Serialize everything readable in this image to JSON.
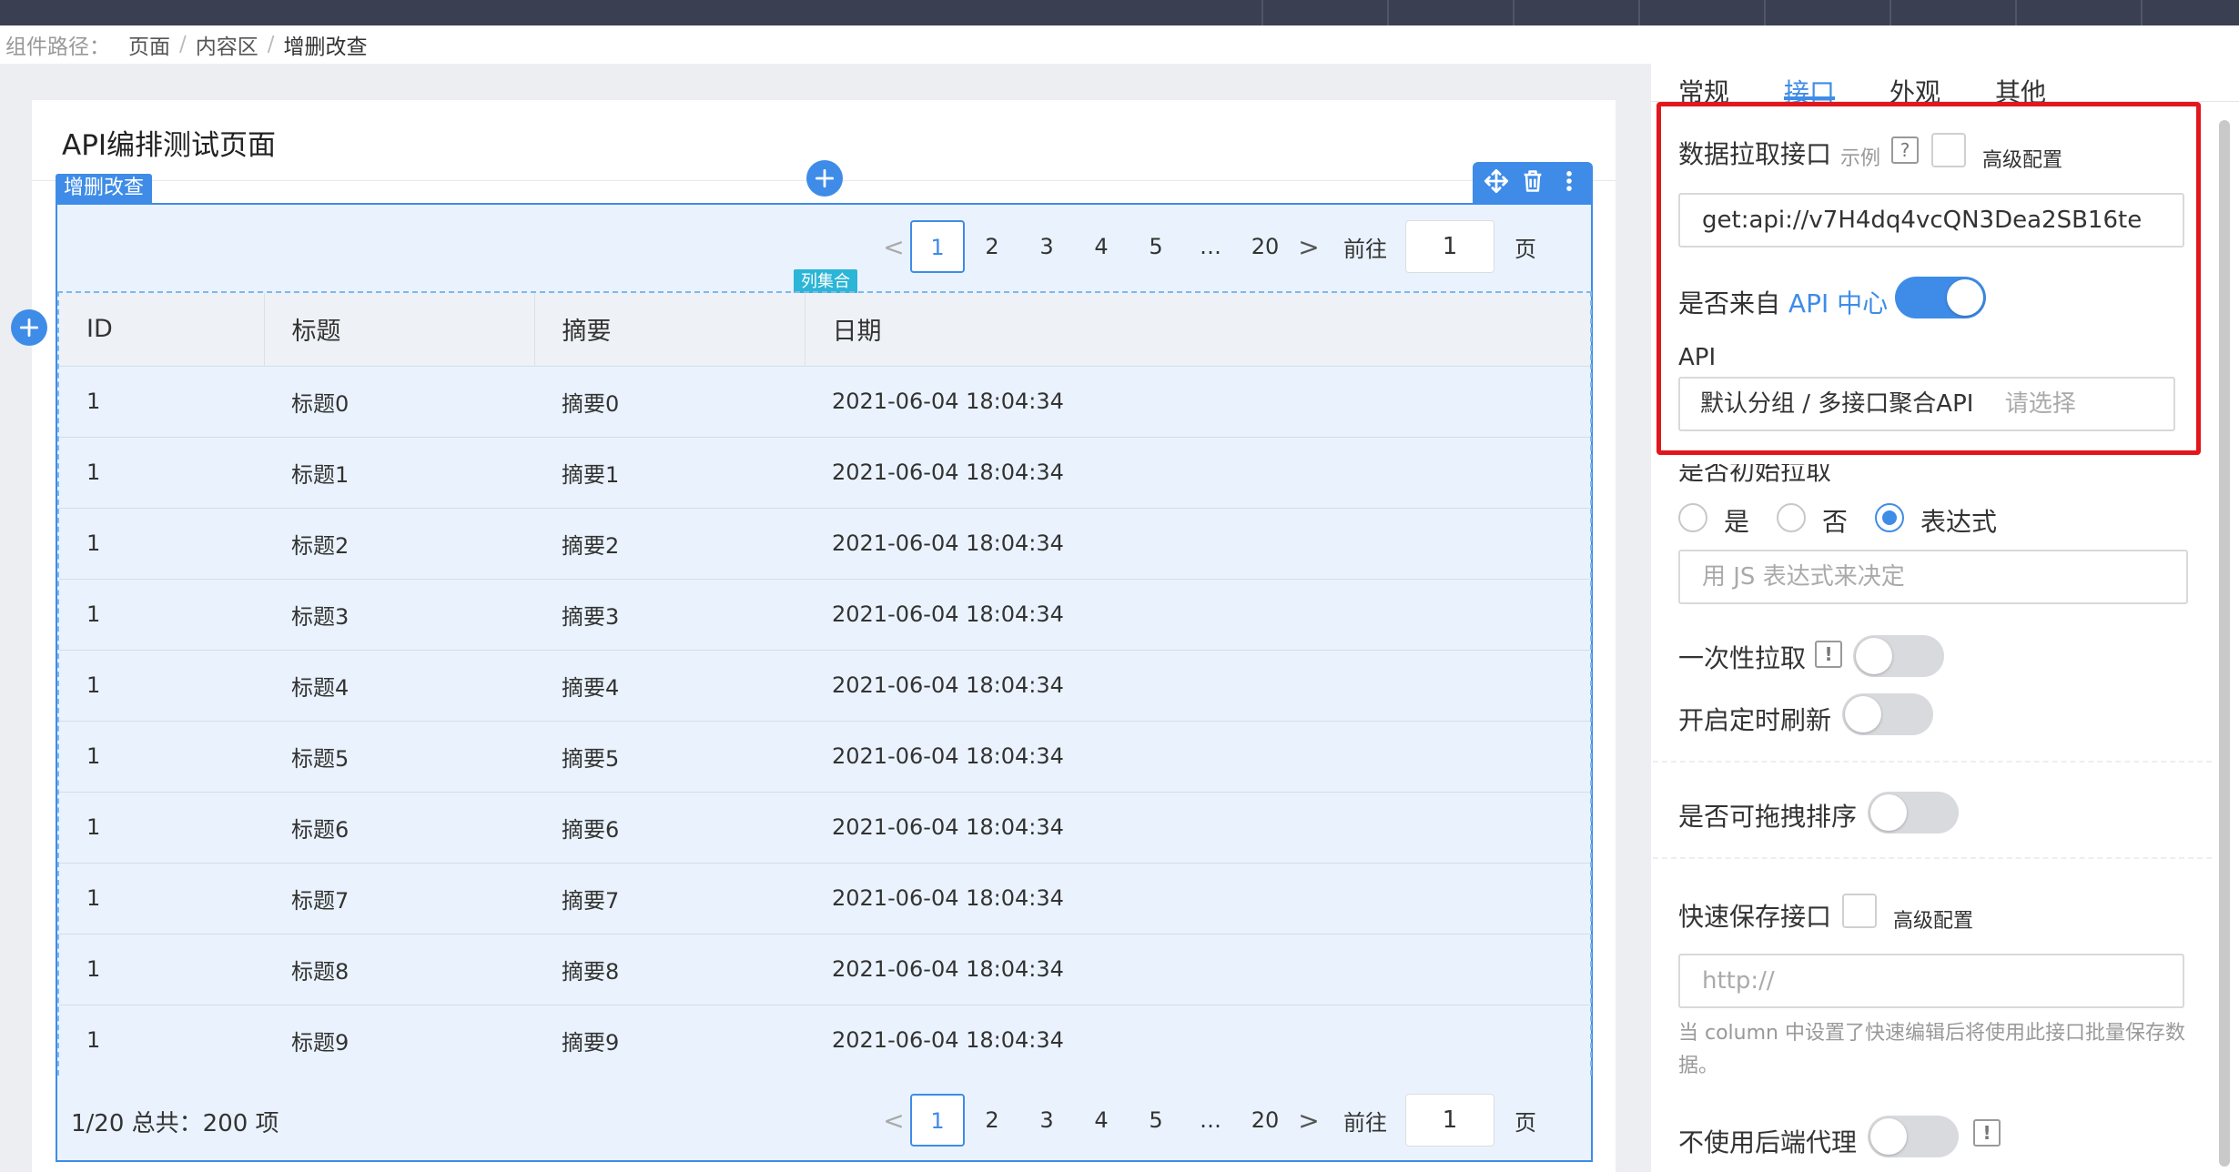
{
  "breadcrumb": {
    "label": "组件路径：",
    "items": [
      "页面",
      "内容区",
      "增删改查"
    ]
  },
  "page": {
    "title": "API编排测试页面",
    "crud_tag": "增删改查",
    "columns_tag": "列集合"
  },
  "pager": {
    "prev": "<",
    "next": ">",
    "pages": [
      "1",
      "2",
      "3",
      "4",
      "5",
      "…",
      "20"
    ],
    "active": "1",
    "goto_label": "前往",
    "goto_value": "1",
    "unit": "页"
  },
  "table": {
    "headers": [
      "ID",
      "标题",
      "摘要",
      "日期"
    ],
    "rows": [
      [
        "1",
        "标题0",
        "摘要0",
        "2021-06-04 18:04:34"
      ],
      [
        "1",
        "标题1",
        "摘要1",
        "2021-06-04 18:04:34"
      ],
      [
        "1",
        "标题2",
        "摘要2",
        "2021-06-04 18:04:34"
      ],
      [
        "1",
        "标题3",
        "摘要3",
        "2021-06-04 18:04:34"
      ],
      [
        "1",
        "标题4",
        "摘要4",
        "2021-06-04 18:04:34"
      ],
      [
        "1",
        "标题5",
        "摘要5",
        "2021-06-04 18:04:34"
      ],
      [
        "1",
        "标题6",
        "摘要6",
        "2021-06-04 18:04:34"
      ],
      [
        "1",
        "标题7",
        "摘要7",
        "2021-06-04 18:04:34"
      ],
      [
        "1",
        "标题8",
        "摘要8",
        "2021-06-04 18:04:34"
      ],
      [
        "1",
        "标题9",
        "摘要9",
        "2021-06-04 18:04:34"
      ]
    ]
  },
  "footer": {
    "summary": "1/20 总共：200 项"
  },
  "panel": {
    "tabs": [
      "常规",
      "接口",
      "外观",
      "其他"
    ],
    "active_tab": "接口",
    "fetch": {
      "label": "数据拉取接口",
      "example": "示例",
      "help": "?",
      "advanced": "高级配置",
      "value": "get:api://v7H4dq4vcQN3Dea2SB16te"
    },
    "api_center": {
      "label": "是否来自",
      "link": "API 中心",
      "on": true
    },
    "api": {
      "label": "API",
      "value": "默认分组 / 多接口聚合API",
      "placeholder": "请选择"
    },
    "init_fetch": {
      "label": "是否初始拉取",
      "options": [
        "是",
        "否",
        "表达式"
      ],
      "selected": "表达式",
      "expr_placeholder": "用 JS 表达式来决定"
    },
    "once": {
      "label": "一次性拉取",
      "badge": "!",
      "on": false
    },
    "interval": {
      "label": "开启定时刷新",
      "on": false
    },
    "draggable": {
      "label": "是否可拖拽排序",
      "on": false
    },
    "quick_save": {
      "label": "快速保存接口",
      "advanced": "高级配置",
      "placeholder": "http://",
      "hint": "当 column 中设置了快速编辑后将使用此接口批量保存数据。"
    },
    "no_proxy": {
      "label": "不使用后端代理",
      "badge": "!",
      "on": false
    }
  },
  "colors": {
    "accent": "#3e8ce8",
    "highlight_border": "#e2171d",
    "topbar": "#3a3f51"
  }
}
